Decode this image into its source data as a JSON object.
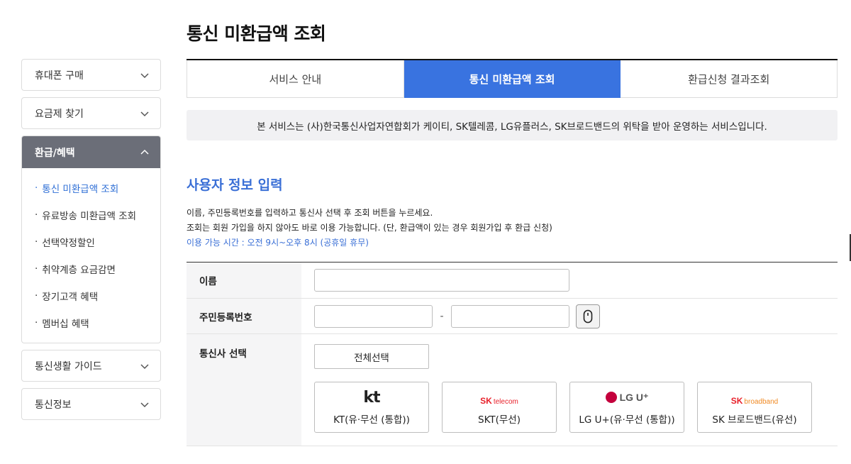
{
  "page_title": "통신 미환급액 조회",
  "sidebar": {
    "menus_top": [
      {
        "label": "휴대폰 구매"
      },
      {
        "label": "요금제 찾기"
      }
    ],
    "active_group": {
      "label": "환급/혜택",
      "items": [
        {
          "label": "통신 미환급액 조회"
        },
        {
          "label": "유료방송 미환급액 조회"
        },
        {
          "label": "선택약정할인"
        },
        {
          "label": "취약계층 요금감면"
        },
        {
          "label": "장기고객 혜택"
        },
        {
          "label": "멤버십 혜택"
        }
      ]
    },
    "menus_bottom": [
      {
        "label": "통신생활 가이드"
      },
      {
        "label": "통신정보"
      }
    ]
  },
  "tabs": [
    {
      "label": "서비스 안내"
    },
    {
      "label": "통신 미환급액 조회"
    },
    {
      "label": "환급신청 결과조회"
    }
  ],
  "notice": "본 서비스는 (사)한국통신사업자연합회가 케이티, SK텔레콤, LG유플러스, SK브로드밴드의 위탁을 받아 운영하는 서비스입니다.",
  "section_title": "사용자 정보 입력",
  "desc": {
    "line1": "이름, 주민등록번호를 입력하고 통신사 선택 후 조회 버튼을 누르세요.",
    "line2": "조회는 회원 가입을 하지 않아도 바로 이용 가능합니다. (단, 환급액이 있는 경우 회원가입 후 환급 신청)",
    "line3": "이용 가능 시간 : 오전 9시~오후 8시 (공휴일 휴무)"
  },
  "form": {
    "name_label": "이름",
    "name_value": "",
    "rrn_label": "주민등록번호",
    "rrn_front_value": "",
    "rrn_back_value": "",
    "rrn_separator": "-",
    "carrier_label": "통신사 선택",
    "select_all_label": "전체선택",
    "carriers": [
      {
        "label": "KT(유·무선 (통합))",
        "logo": "kt"
      },
      {
        "label": "SKT(무선)",
        "logo_main": "SK",
        "logo_sub": "telecom"
      },
      {
        "label": "LG U+(유·무선 (통합))",
        "logo_text": "LG U⁺"
      },
      {
        "label": "SK 브로드밴드(유선)",
        "logo_main": "SK",
        "logo_sub": "broadband"
      }
    ]
  },
  "colors": {
    "accent": "#3973e0",
    "sidebar_active": "#6b6e78",
    "sk_red": "#e8202a",
    "lg_magenta": "#c4003c"
  }
}
